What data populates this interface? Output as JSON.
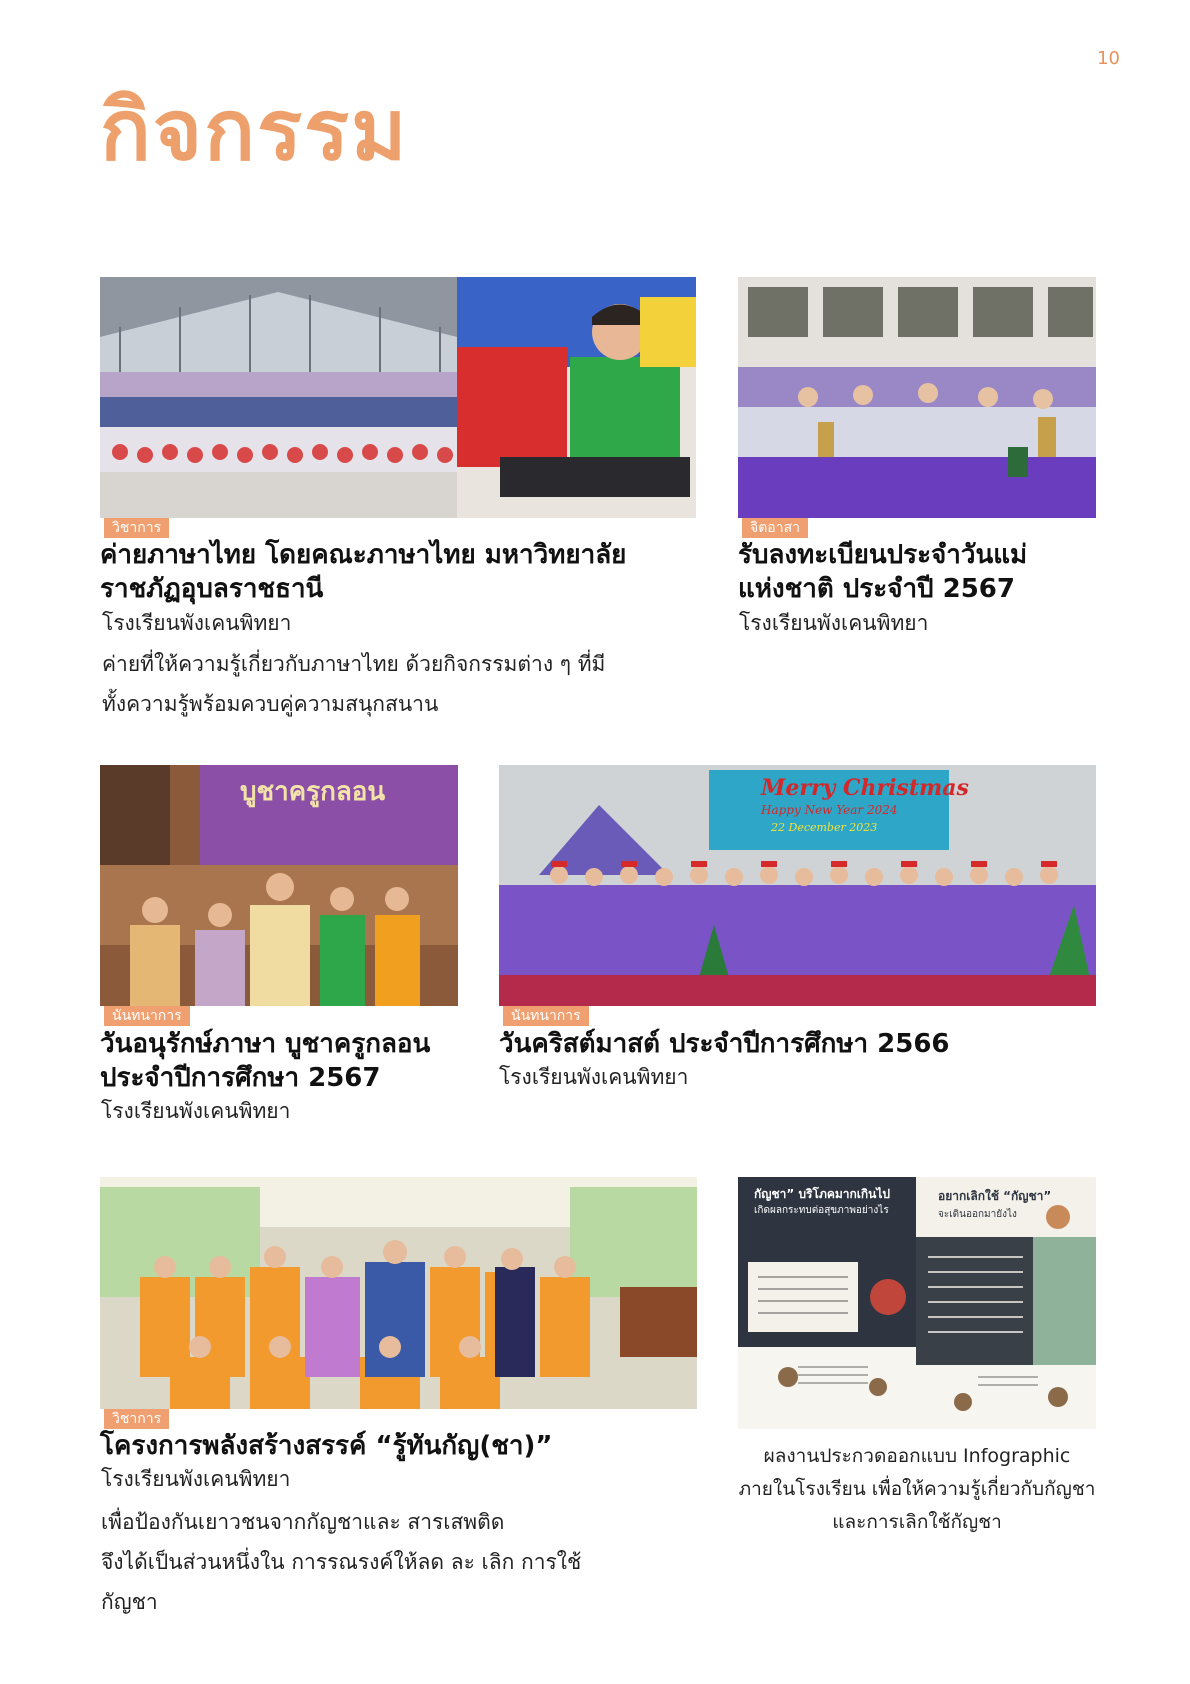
{
  "page": {
    "number": "10",
    "title": "กิจกรรม"
  },
  "cards": [
    {
      "tag": "วิชาการ",
      "title_line1": "ค่ายภาษาไทย โดยคณะภาษาไทย มหาวิทยาลัย",
      "title_line2": "ราชภัฏอุบลราชธานี",
      "school": "โรงเรียนพังเคนพิทยา",
      "desc_line1": "ค่ายที่ให้ความรู้เกี่ยวกับภาษาไทย ด้วยกิจกรรมต่าง ๆ ที่มี",
      "desc_line2": "ทั้งความรู้พร้อมควบคู่ความสนุกสนาน"
    },
    {
      "tag": "จิตอาสา",
      "title_line1": "รับลงทะเบียนประจำวันแม่",
      "title_line2": "แห่งชาติ ประจำปี 2567",
      "school": "โรงเรียนพังเคนพิทยา"
    },
    {
      "tag": "นันทนาการ",
      "title_line1": "วันอนุรักษ์ภาษา บูชาครูกลอน",
      "title_line2": "ประจำปีการศึกษา 2567",
      "school": "โรงเรียนพังเคนพิทยา",
      "photo_banner": "บูชาครูกลอน"
    },
    {
      "tag": "นันทนาการ",
      "title_line1": "วันคริสต์มาสต์ ประจำปีการศึกษา 2566",
      "school": "โรงเรียนพังเคนพิทยา",
      "photo_banner": "Merry Christmas",
      "photo_sub": "Happy New Year 2024",
      "photo_date": "22 December 2023"
    },
    {
      "tag": "วิชาการ",
      "title_line1": "โครงการพลังสร้างสรรค์ “รู้ทันกัญ(ชา)”",
      "school": "โรงเรียนพังเคนพิทยา",
      "desc_line1": "เพื่อป้องกันเยาวชนจากกัญชาและ สารเสพติด",
      "desc_line2": "จึงได้เป็นส่วนหนึ่งใน การรณรงค์ให้ลด ละ เลิก การใช้",
      "desc_line3": "กัญชา"
    },
    {
      "caption_line1": "ผลงานประกวดออกแบบ Infographic",
      "caption_line2": "ภายในโรงเรียน เพื่อให้ความรู้เกี่ยวกับกัญชา",
      "caption_line3": "และการเลิกใช้กัญชา",
      "infographic_left_title": "กัญชา” บริโภคมากเกินไป",
      "infographic_left_sub": "เกิดผลกระทบต่อสุขภาพอย่างไร",
      "infographic_right_title": "อยากเลิกใช้ “กัญชา”",
      "infographic_right_sub": "จะเดินออกมายังไง"
    }
  ],
  "colors": {
    "accent": "#eea06c",
    "tag": "#f0a070",
    "page_number": "#e8925a"
  }
}
